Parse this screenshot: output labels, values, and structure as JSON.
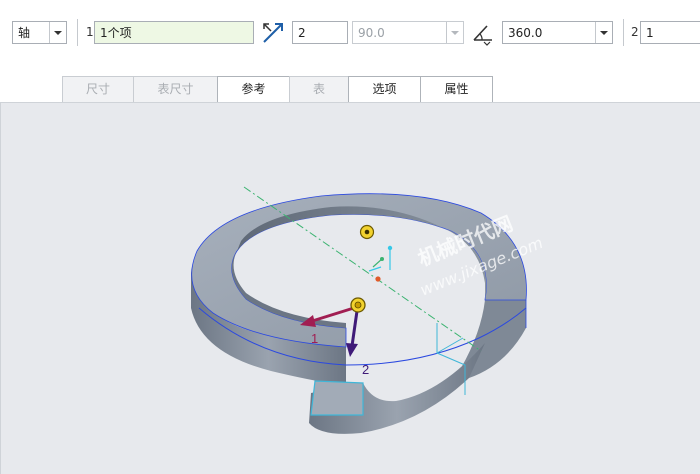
{
  "toolbar": {
    "type_select": "轴",
    "ref_index": "1",
    "ref_value": "1个项",
    "member_count": "2",
    "spacing_value": "90.0",
    "angle_value": "360.0",
    "second_index": "2",
    "second_value": "1"
  },
  "tabs": [
    {
      "label": "尺寸",
      "enabled": false
    },
    {
      "label": "表尺寸",
      "enabled": false
    },
    {
      "label": "参考",
      "enabled": true
    },
    {
      "label": "表",
      "enabled": false
    },
    {
      "label": "选项",
      "enabled": true
    },
    {
      "label": "属性",
      "enabled": true
    }
  ],
  "viewport": {
    "direction_label_1": "1",
    "direction_label_2": "2",
    "watermark_line1": "机械时代网",
    "watermark_line2": "www.jixage.com",
    "colors": {
      "background": "#e7e9ed",
      "part_top": "#9ea7b3",
      "part_side": "#7d8794",
      "edge": "#2b49e0",
      "axis": "#3cb371",
      "arrow_1": "#a11e52",
      "arrow_2": "#3f1a78",
      "handle": "#f2d22e"
    }
  }
}
